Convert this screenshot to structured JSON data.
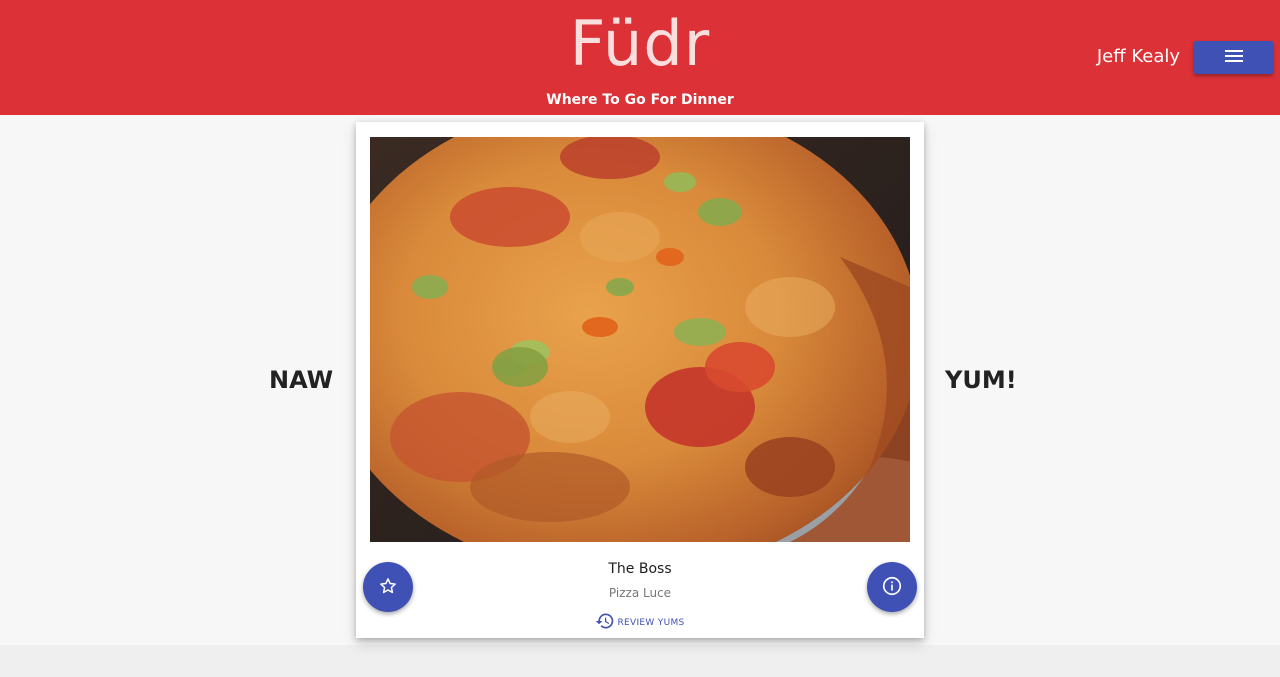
{
  "header": {
    "app_title": "Füdr",
    "tagline": "Where To Go For Dinner",
    "user_name": "Jeff Kealy",
    "menu_icon": "hamburger-menu-icon"
  },
  "swipe": {
    "left_label": "NAW",
    "right_label": "YUM!"
  },
  "card": {
    "photo": "pizza-photo",
    "dish_name": "The Boss",
    "restaurant_name": "Pizza Luce",
    "review_link_label": "REVIEW YUMS",
    "review_icon": "history-icon",
    "left_action_icon": "star-outline-icon",
    "right_action_icon": "info-icon"
  },
  "colors": {
    "header_bg": "#dc3237",
    "accent": "#3f51b5",
    "page_bg": "#f7f7f7"
  }
}
